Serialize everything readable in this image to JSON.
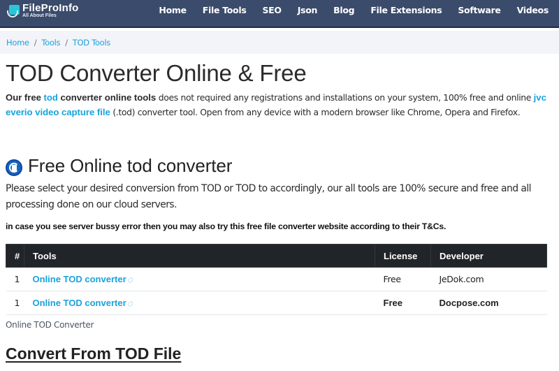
{
  "header": {
    "logo": {
      "name": "FileProInfo",
      "tagline": "All About Files"
    },
    "nav": [
      {
        "label": "Home"
      },
      {
        "label": "File Tools"
      },
      {
        "label": "SEO"
      },
      {
        "label": "Json"
      },
      {
        "label": "Blog"
      },
      {
        "label": "File Extensions"
      },
      {
        "label": "Software"
      },
      {
        "label": "Videos"
      }
    ]
  },
  "breadcrumb": [
    {
      "label": "Home"
    },
    {
      "label": "Tools"
    },
    {
      "label": "TOD Tools"
    }
  ],
  "breadcrumb_separator": "/",
  "page": {
    "title": "TOD Converter Online & Free",
    "intro": {
      "b1": "Our free ",
      "link1": "tod",
      "b2": " converter online tools",
      "t1": " does not required any registrations and installations on your system, 100% free and online ",
      "link2": "jvc everio video capture file",
      "t2": " (.tod) converter tool. Open from any device with a modern browser like Chrome, Opera and Firefox."
    }
  },
  "section": {
    "icon": "converter-icon",
    "title": "Free Online tod converter",
    "description": "Please select your desired conversion from TOD or TOD to accordingly, our all tools are 100% secure and free and all processing done on our cloud servers.",
    "notice": "in case you see server bussy error then you may also try this free file converter website according to their T&Cs."
  },
  "table": {
    "headers": [
      "#",
      "Tools",
      "License",
      "Developer"
    ],
    "rows": [
      {
        "num": "1",
        "tool": "Online TOD converter",
        "license": "Free",
        "developer": "JeDok.com",
        "bold": false
      },
      {
        "num": "1",
        "tool": "Online TOD converter",
        "license": "Free",
        "developer": "Docpose.com",
        "bold": true
      }
    ],
    "link_icon": "link-icon",
    "caption": "Online TOD Converter"
  },
  "convert_heading": "Convert From TOD File",
  "colors": {
    "navbar": "#3b4b6b",
    "accent": "#18a3dc",
    "table_header": "#212529",
    "breadcrumb_bg": "#f3f4f9"
  }
}
